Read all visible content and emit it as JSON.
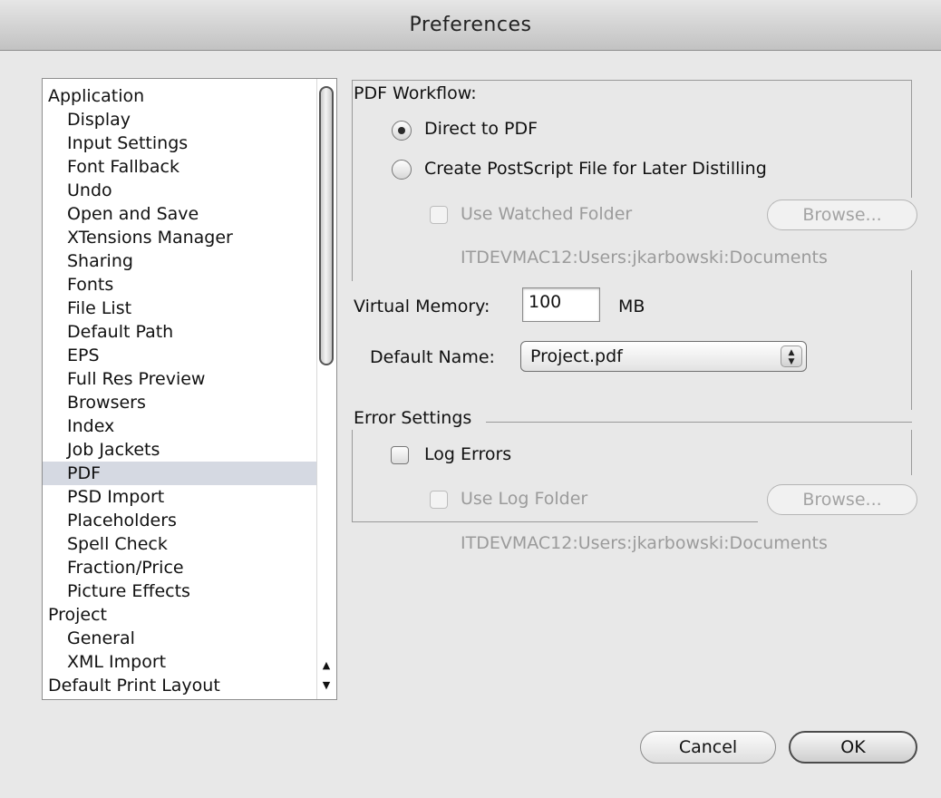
{
  "window": {
    "title": "Preferences"
  },
  "sidebar": {
    "items": [
      {
        "label": "Application",
        "child": false,
        "selected": false
      },
      {
        "label": "Display",
        "child": true,
        "selected": false
      },
      {
        "label": "Input Settings",
        "child": true,
        "selected": false
      },
      {
        "label": "Font Fallback",
        "child": true,
        "selected": false
      },
      {
        "label": "Undo",
        "child": true,
        "selected": false
      },
      {
        "label": "Open and Save",
        "child": true,
        "selected": false
      },
      {
        "label": "XTensions Manager",
        "child": true,
        "selected": false
      },
      {
        "label": "Sharing",
        "child": true,
        "selected": false
      },
      {
        "label": "Fonts",
        "child": true,
        "selected": false
      },
      {
        "label": "File List",
        "child": true,
        "selected": false
      },
      {
        "label": "Default Path",
        "child": true,
        "selected": false
      },
      {
        "label": "EPS",
        "child": true,
        "selected": false
      },
      {
        "label": "Full Res Preview",
        "child": true,
        "selected": false
      },
      {
        "label": "Browsers",
        "child": true,
        "selected": false
      },
      {
        "label": "Index",
        "child": true,
        "selected": false
      },
      {
        "label": "Job Jackets",
        "child": true,
        "selected": false
      },
      {
        "label": "PDF",
        "child": true,
        "selected": true
      },
      {
        "label": "PSD Import",
        "child": true,
        "selected": false
      },
      {
        "label": "Placeholders",
        "child": true,
        "selected": false
      },
      {
        "label": "Spell Check",
        "child": true,
        "selected": false
      },
      {
        "label": "Fraction/Price",
        "child": true,
        "selected": false
      },
      {
        "label": "Picture Effects",
        "child": true,
        "selected": false
      },
      {
        "label": "Project",
        "child": false,
        "selected": false
      },
      {
        "label": "General",
        "child": true,
        "selected": false
      },
      {
        "label": "XML Import",
        "child": true,
        "selected": false
      },
      {
        "label": "Default Print Layout",
        "child": false,
        "selected": false
      }
    ]
  },
  "pdf_workflow": {
    "heading": "PDF Workflow:",
    "direct_label": "Direct to PDF",
    "postscript_label": "Create PostScript File for Later Distilling",
    "selected": "direct",
    "watched_folder_label": "Use Watched Folder",
    "watched_folder_checked": false,
    "browse_label": "Browse...",
    "watched_folder_path": "ITDEVMAC12:Users:jkarbowski:Documents"
  },
  "virtual_memory": {
    "label": "Virtual Memory:",
    "value": "100",
    "unit": "MB"
  },
  "default_name": {
    "label": "Default Name:",
    "value": "Project.pdf"
  },
  "error_settings": {
    "heading": "Error Settings",
    "log_errors_label": "Log Errors",
    "log_errors_checked": false,
    "log_folder_label": "Use Log Folder",
    "log_folder_checked": false,
    "browse_label": "Browse...",
    "log_folder_path": "ITDEVMAC12:Users:jkarbowski:Documents"
  },
  "buttons": {
    "cancel": "Cancel",
    "ok": "OK"
  }
}
